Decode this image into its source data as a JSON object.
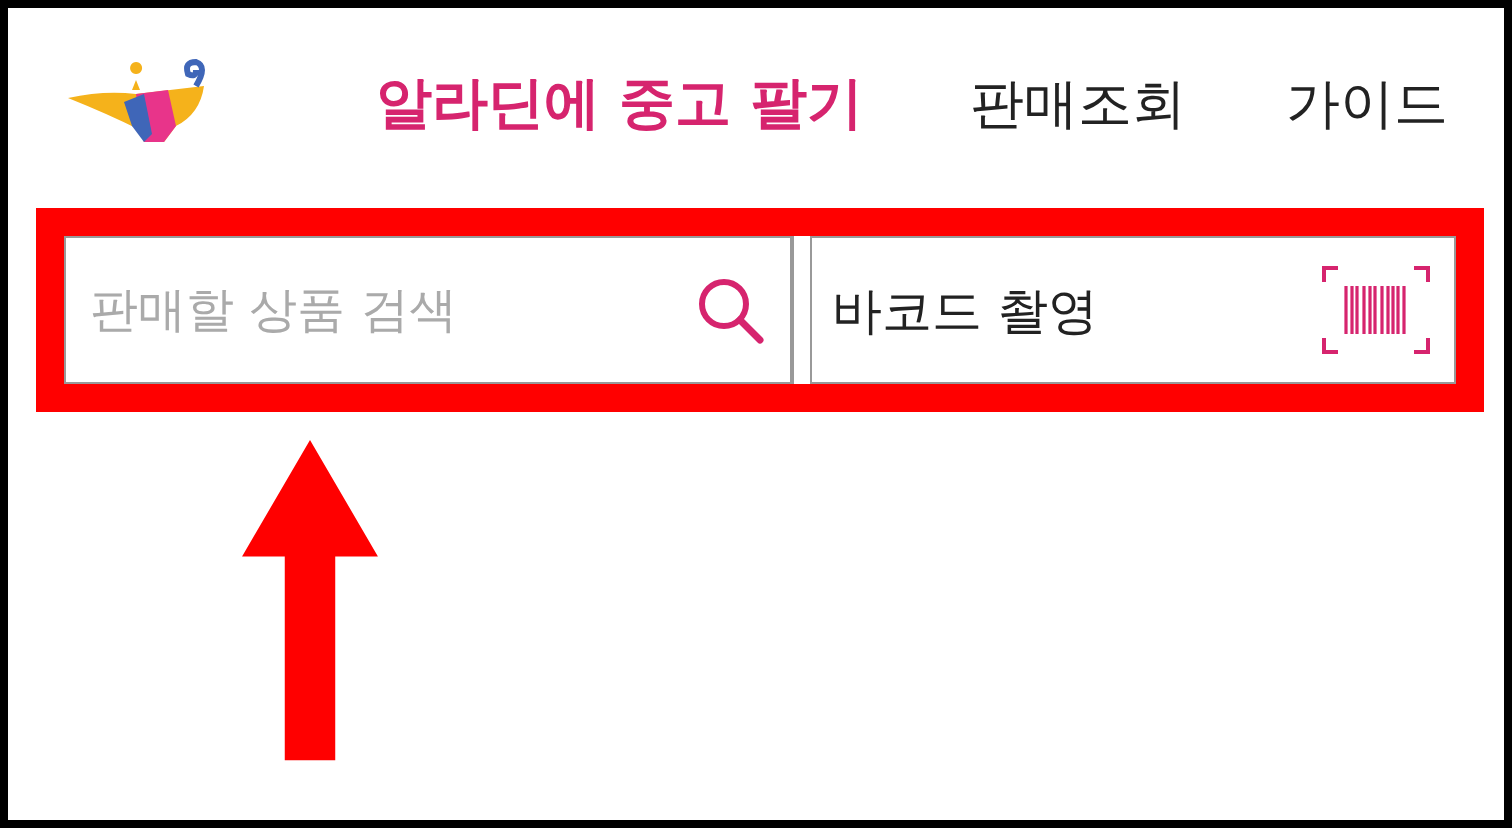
{
  "header": {
    "title": "알라딘에 중고 팔기",
    "nav": [
      {
        "label": "판매조회"
      },
      {
        "label": "가이드"
      }
    ]
  },
  "search": {
    "placeholder": "판매할 상품 검색"
  },
  "barcode": {
    "label": "바코드 촬영"
  }
}
